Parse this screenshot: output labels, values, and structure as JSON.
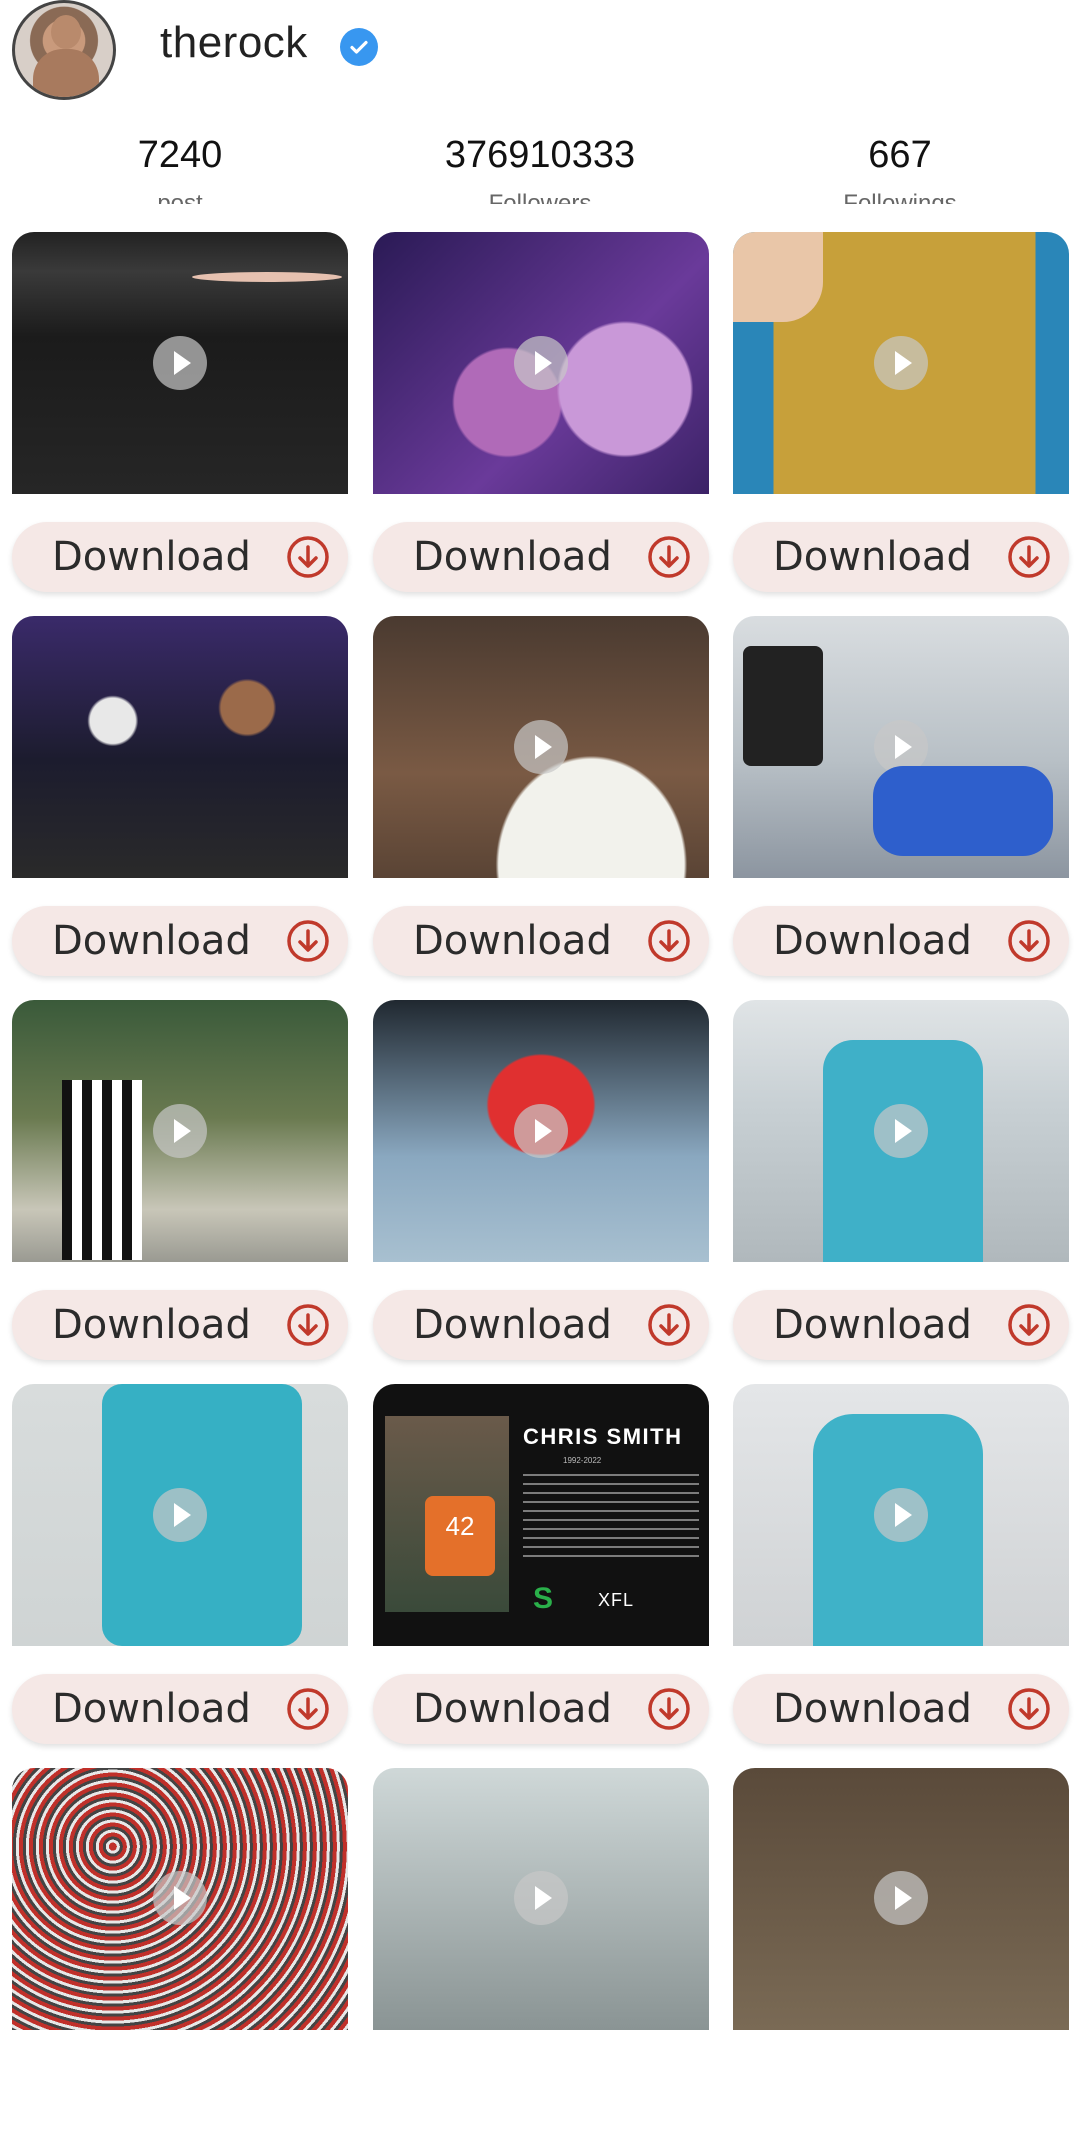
{
  "profile": {
    "username": "therock",
    "verified": true
  },
  "stats": [
    {
      "value": "7240",
      "label": "post"
    },
    {
      "value": "376910333",
      "label": "Followers"
    },
    {
      "value": "667",
      "label": "Followings"
    }
  ],
  "posts": [
    {
      "type": "video",
      "download_label": "Download"
    },
    {
      "type": "video",
      "download_label": "Download"
    },
    {
      "type": "video",
      "download_label": "Download"
    },
    {
      "type": "image",
      "download_label": "Download"
    },
    {
      "type": "video",
      "download_label": "Download"
    },
    {
      "type": "video",
      "download_label": "Download"
    },
    {
      "type": "video",
      "download_label": "Download"
    },
    {
      "type": "video",
      "download_label": "Download"
    },
    {
      "type": "video",
      "download_label": "Download"
    },
    {
      "type": "video",
      "download_label": "Download"
    },
    {
      "type": "image",
      "download_label": "Download",
      "card_title": "CHRIS SMITH",
      "card_years": "1992-2022",
      "card_logo": "XFL",
      "jersey_number": "42"
    },
    {
      "type": "video",
      "download_label": "Download"
    },
    {
      "type": "video",
      "download_label": "Download"
    },
    {
      "type": "video",
      "download_label": "Download"
    },
    {
      "type": "video",
      "download_label": "Download"
    }
  ],
  "colors": {
    "accent": "#c0392b",
    "button_bg": "#f5e8e6",
    "verified": "#3897f0"
  },
  "icons": {
    "verified": "verified-badge-icon",
    "download": "download-circle-icon",
    "play": "play-icon"
  }
}
